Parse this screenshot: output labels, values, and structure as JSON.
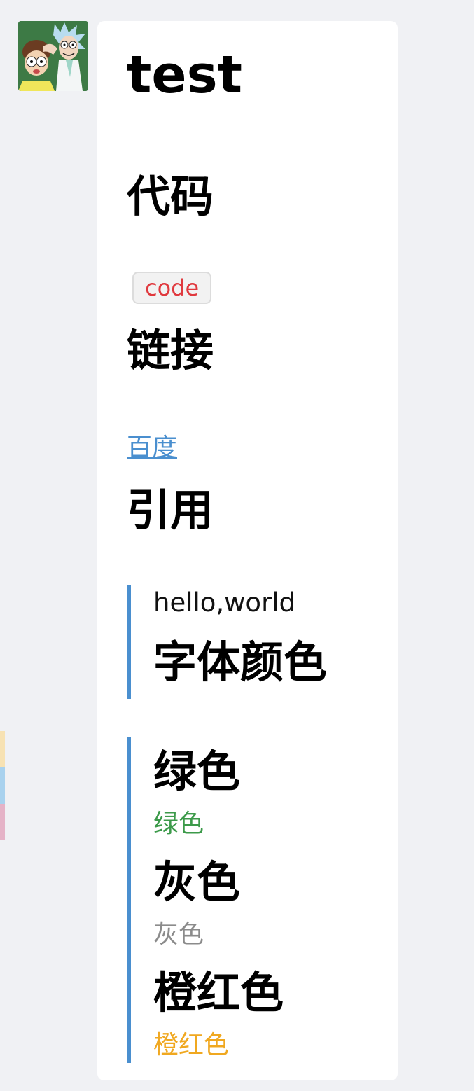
{
  "avatar": {
    "icon": "rick-and-morty-avatar-icon"
  },
  "side_tabs": {
    "colors": [
      "#f7e2b3",
      "#a9d2ee",
      "#e5b3c7"
    ]
  },
  "message": {
    "title": "test",
    "code_section": {
      "heading": "代码",
      "code": "code"
    },
    "link_section": {
      "heading": "链接",
      "link_text": "百度"
    },
    "quote_section": {
      "heading": "引用",
      "quote_text": "hello,world",
      "quote_heading": "字体颜色"
    },
    "colors_section": {
      "green": {
        "heading": "绿色",
        "text": "绿色",
        "color": "#3c9a4a"
      },
      "gray": {
        "heading": "灰色",
        "text": "灰色",
        "color": "#8b8b8b"
      },
      "orange": {
        "heading": "橙红色",
        "text": "橙红色",
        "color": "#f0a820"
      }
    },
    "accent_color": "#4a8fcf",
    "code_color": "#e0393e"
  }
}
